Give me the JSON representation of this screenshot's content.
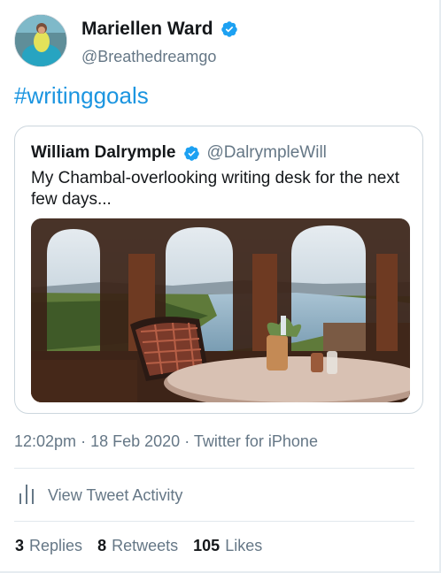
{
  "author": {
    "display_name": "Mariellen Ward",
    "handle": "@Breathedreamgo",
    "verified": true
  },
  "tweet": {
    "text": "#writinggoals",
    "link_color": "#1b95e0"
  },
  "quoted_tweet": {
    "display_name": "William Dalrymple",
    "handle": "@DalrympleWill",
    "verified": true,
    "text": "My Chambal-overlooking writing desk for the next few days..."
  },
  "meta": {
    "time": "12:02pm",
    "date": "18 Feb 2020",
    "source": "Twitter for iPhone",
    "separator": "·"
  },
  "activity": {
    "label": "View Tweet Activity",
    "icon": "bar-chart-icon"
  },
  "stats": {
    "replies_count": "3",
    "replies_label": "Replies",
    "retweets_count": "8",
    "retweets_label": "Retweets",
    "likes_count": "105",
    "likes_label": "Likes"
  },
  "colors": {
    "verified_badge": "#1da1f2",
    "secondary_text": "#657786",
    "primary_text": "#14171a"
  }
}
